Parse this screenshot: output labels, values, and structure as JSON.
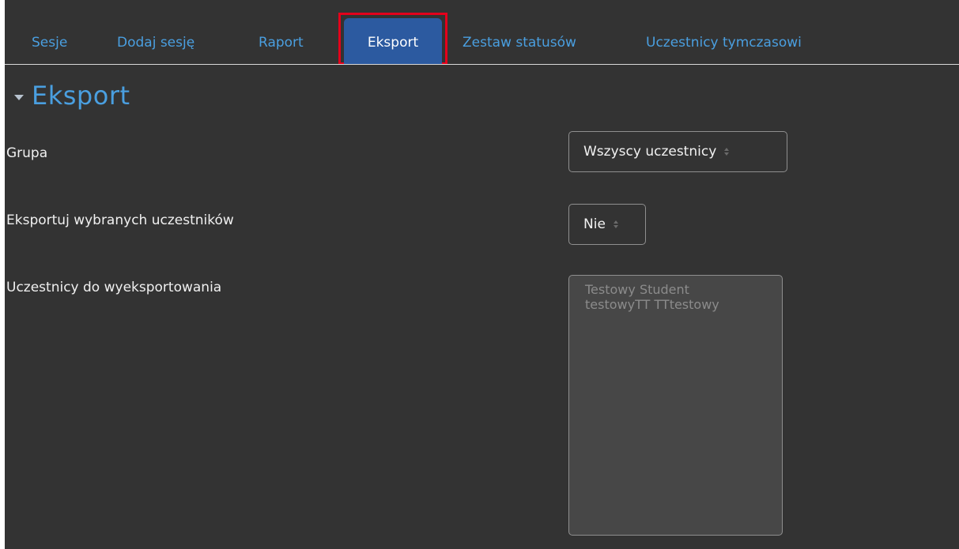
{
  "tabs": {
    "items": [
      {
        "label": "Sesje"
      },
      {
        "label": "Dodaj sesję"
      },
      {
        "label": "Raport"
      },
      {
        "label": "Eksport"
      },
      {
        "label": "Zestaw statusów"
      },
      {
        "label": "Uczestnicy tymczasowi"
      }
    ],
    "active_index": 3
  },
  "section": {
    "title": "Eksport",
    "collapse_icon": "caret-down-icon"
  },
  "form": {
    "group": {
      "label": "Grupa",
      "value": "Wszyscy uczestnicy"
    },
    "export_selected": {
      "label": "Eksportuj wybranych uczestników",
      "value": "Nie"
    },
    "participants": {
      "label": "Uczestnicy do wyeksportowania",
      "options": [
        "Testowy Student",
        "testowyTT TTtestowy"
      ]
    }
  },
  "colors": {
    "background": "#333333",
    "link": "#4a9fe0",
    "active_tab": "#2c5aa0",
    "highlight": "#e4001b"
  }
}
